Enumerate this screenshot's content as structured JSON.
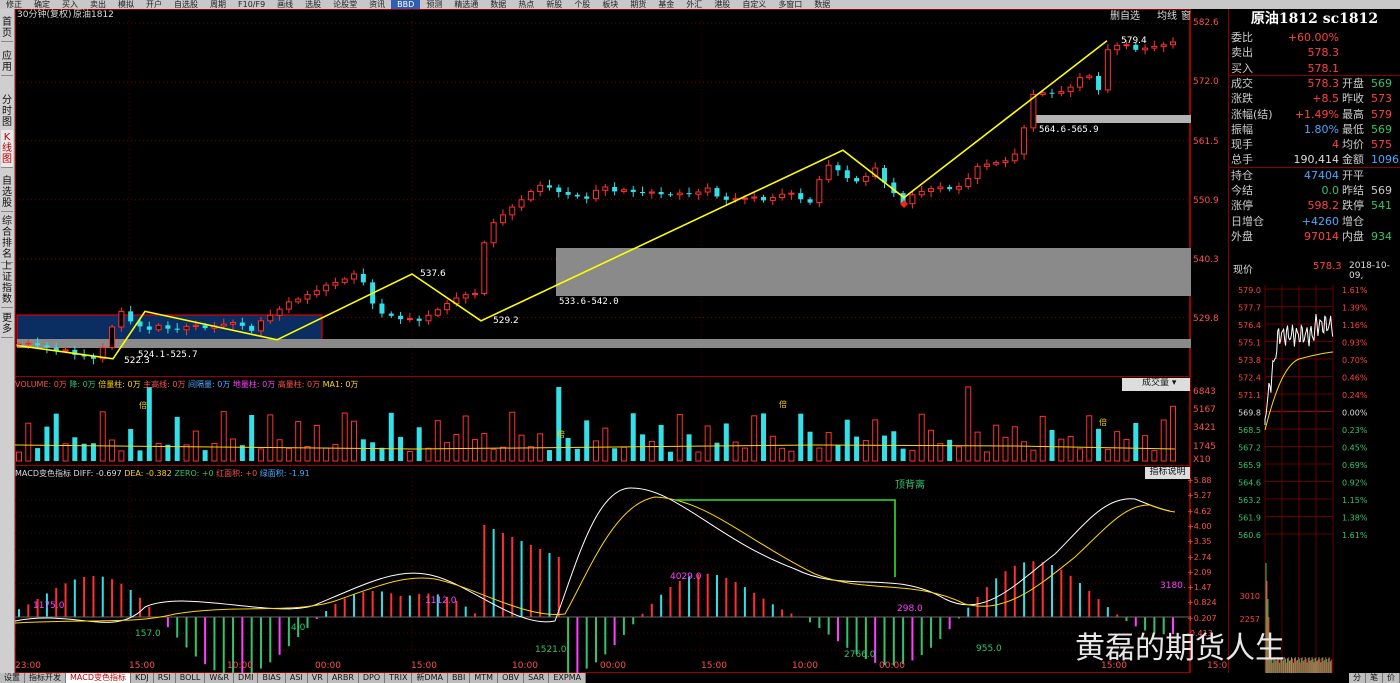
{
  "toolbar": {
    "items": [
      "修正",
      "确定",
      "买入",
      "卖出",
      "模拟",
      "开户",
      "自选股",
      "周期",
      "F10/F9",
      "画线",
      "选股",
      "论股堂",
      "资讯",
      "BBD",
      "预测",
      "精选通",
      "数据",
      "热点",
      "新股",
      "个股",
      "板块",
      "期货",
      "基金",
      "外汇",
      "港股",
      "自定义",
      "多窗口",
      "数据"
    ]
  },
  "sidebar": {
    "items": [
      "首页",
      "应用",
      "分时图",
      "K线图",
      "自选股",
      "综合排名",
      "上证指数",
      "更多"
    ]
  },
  "chart": {
    "header_period": "30分钟(复权)",
    "header_symbol": "原油1812",
    "btn_fav": "删自选",
    "btn_avg": "均线",
    "btn_win": "窗",
    "price_axis": [
      "582.6",
      "572.0",
      "561.5",
      "550.9",
      "540.3",
      "529.8"
    ],
    "annotations": {
      "p1": "579.4",
      "p2": "564.6-565.9",
      "p3": "537.6",
      "p4": "533.6-542.0",
      "p5": "529.2",
      "p6": "524.1-525.7",
      "p7": "522.3"
    },
    "vol_legend": {
      "a": "VOLUME: 0万",
      "b": "降: 0万",
      "c": "倍量柱: 0万",
      "d": "主高线: 0万",
      "e": "间隔量: 0万",
      "f": "地量柱: 0万",
      "g": "高量柱: 0万",
      "h": "MA1: 0万"
    },
    "vol_dropdown": "成交量",
    "vol_axis": [
      "6843",
      "5167",
      "3421",
      "1745",
      "X10"
    ],
    "vol_mark": "倍",
    "macd_legend": {
      "a": "MACD变色指标",
      "b": "DIFF: -0.697",
      "c": "DEA: -0.382",
      "d": "ZERO: +0",
      "e": "红面积: +0",
      "f": "绿面积: -1.91"
    },
    "macd_btn": "指标说明",
    "macd_axis": [
      "+5.88",
      "+5.27",
      "+4.62",
      "+4.00",
      "+3.35",
      "+2.74",
      "+2.09",
      "+1.47",
      "+0.824",
      "+0.207",
      "-0.413"
    ],
    "macd_div": "顶背离",
    "macd_nums": {
      "a": "1175.0",
      "b": "157.0",
      "c": "4.0",
      "d": "1112.0",
      "e": "1521.0",
      "f": "4029.0",
      "g": "2766.0",
      "h": "298.0",
      "i": "955.0",
      "j": "3180."
    },
    "time_axis": [
      "23:00",
      "15:00",
      "10:00",
      "00:00",
      "15:00",
      "10:00",
      "00:00",
      "15:00",
      "10:00",
      "00:00",
      "15:00",
      "15:00"
    ]
  },
  "chart_data": [
    {
      "type": "candlestick",
      "title": "原油1812",
      "period": "30分钟(复权)",
      "y_range": [
        522,
        582.6
      ],
      "close": [
        525,
        525.2,
        524.8,
        524.4,
        523.8,
        524,
        523.1,
        522.8,
        522.4,
        524.4,
        528.1,
        530.9,
        529.1,
        528.2,
        527.6,
        528.4,
        527.8,
        527.6,
        528.2,
        528.4,
        527.9,
        528.3,
        528.6,
        528.9,
        528.3,
        527.4,
        529.2,
        530.2,
        531.3,
        532.6,
        533.1,
        533.9,
        534.6,
        535.6,
        536.1,
        536.7,
        537.6,
        536.1,
        532.3,
        530.5,
        530.1,
        529.5,
        529.6,
        529.2,
        530.2,
        531.2,
        532.3,
        533.3,
        533.9,
        534.1,
        543.2,
        546.8,
        548.2,
        549.6,
        550.9,
        552.4,
        553.5,
        553.1,
        552.3,
        551.8,
        551.5,
        551.1,
        552.6,
        553.2,
        552.4,
        552.7,
        552.3,
        552.1,
        552.3,
        551.9,
        551.8,
        552.1,
        551.9,
        552.3,
        553,
        551.5,
        550.9,
        551.1,
        551.2,
        551.4,
        550.8,
        551.3,
        551.9,
        552.1,
        551,
        550.4,
        554.5,
        557.1,
        556.2,
        554.8,
        554.2,
        555.1,
        556.6,
        554,
        552.1,
        550.2,
        551.8,
        552.4,
        552.9,
        553.2,
        552.8,
        553.3,
        554.7,
        556.9,
        557.3,
        557.6,
        557.9,
        559.1,
        563.8,
        569.8,
        570.1,
        570,
        570.3,
        571.1,
        572.8,
        573.1,
        570.6,
        577.8,
        578.6,
        578.7,
        577.8,
        578.1,
        578.4,
        578.7,
        579.2
      ]
    },
    {
      "type": "bar",
      "title": "VOLUME",
      "y_range": [
        0,
        6843
      ]
    },
    {
      "type": "line",
      "title": "MACD变色指标",
      "series": [
        {
          "name": "DIFF",
          "last": -0.697
        },
        {
          "name": "DEA",
          "last": -0.382
        }
      ],
      "y_range": [
        -0.413,
        5.88
      ]
    }
  ],
  "quote": {
    "title": "原油1812 sc1812",
    "rows": [
      {
        "k": "委比",
        "v": "+60.00%",
        "vc": "#ff4040"
      },
      {
        "k": "卖出",
        "v": "578.3",
        "vc": "#ff4040"
      },
      {
        "k": "买入",
        "v": "578.1",
        "vc": "#ff4040"
      },
      {
        "k": "成交",
        "v": "578.3",
        "vc": "#ff4040",
        "k2": "开盘",
        "v2": "569",
        "v2c": "#31c46d"
      },
      {
        "k": "涨跌",
        "v": "+8.5",
        "vc": "#ff4040",
        "k2": "昨收",
        "v2": "573",
        "v2c": "#ff4040"
      },
      {
        "k": "涨幅(结)",
        "v": "+1.49%",
        "vc": "#ff4040",
        "k2": "最高",
        "v2": "579",
        "v2c": "#ff4040"
      },
      {
        "k": "振幅",
        "v": "1.80%",
        "vc": "#4aa8ff",
        "k2": "最低",
        "v2": "569",
        "v2c": "#31c46d"
      },
      {
        "k": "现手",
        "v": "4",
        "vc": "#ff4040",
        "k2": "均价",
        "v2": "575",
        "v2c": "#ff4040"
      },
      {
        "k": "总手",
        "v": "190,414",
        "vc": "#ddd",
        "k2": "金额",
        "v2": "1096",
        "v2c": "#4aa8ff"
      },
      {
        "k": "持仓",
        "v": "47404",
        "vc": "#4aa8ff",
        "k2": "开平",
        "v2": "",
        "v2c": "#ccc"
      },
      {
        "k": "今结",
        "v": "0.0",
        "vc": "#31c46d",
        "k2": "昨结",
        "v2": "569",
        "v2c": "#ccc"
      },
      {
        "k": "涨停",
        "v": "598.2",
        "vc": "#ff4040",
        "k2": "跌停",
        "v2": "541",
        "v2c": "#31c46d"
      },
      {
        "k": "日增仓",
        "v": "+4260",
        "vc": "#4aa8ff",
        "k2": "增仓",
        "v2": "",
        "v2c": "#ccc"
      },
      {
        "k": "外盘",
        "v": "97014",
        "vc": "#ff4040",
        "k2": "内盘",
        "v2": "934",
        "v2c": "#31c46d"
      }
    ],
    "price_label": "现价",
    "price_val": "578.3",
    "date": "2018-10-09,",
    "mini_left": [
      "579.0",
      "577.7",
      "576.4",
      "575.1",
      "573.8",
      "572.4",
      "571.1",
      "569.8",
      "568.5",
      "567.2",
      "565.9",
      "564.6",
      "563.2",
      "561.9",
      "560.6"
    ],
    "mini_right": [
      "1.61%",
      "1.39%",
      "1.16%",
      "0.93%",
      "0.70%",
      "0.46%",
      "0.24%",
      "0.00%",
      "0.23%",
      "0.45%",
      "0.69%",
      "0.92%",
      "1.15%",
      "1.38%",
      "1.61%"
    ],
    "mini_vol": [
      "3010",
      "2257"
    ]
  },
  "bottombar": {
    "items": [
      "设置",
      "指标开发",
      "MACD变色指标",
      "KDJ",
      "RSI",
      "BOLL",
      "W&R",
      "DMI",
      "BIAS",
      "ASI",
      "VR",
      "ARBR",
      "DPO",
      "TRIX",
      "新DMA",
      "BBI",
      "MTM",
      "OBV",
      "SAR",
      "EXPMA"
    ],
    "right": [
      "分",
      "笔",
      "价"
    ]
  },
  "watermark": "黄磊的期货人生"
}
